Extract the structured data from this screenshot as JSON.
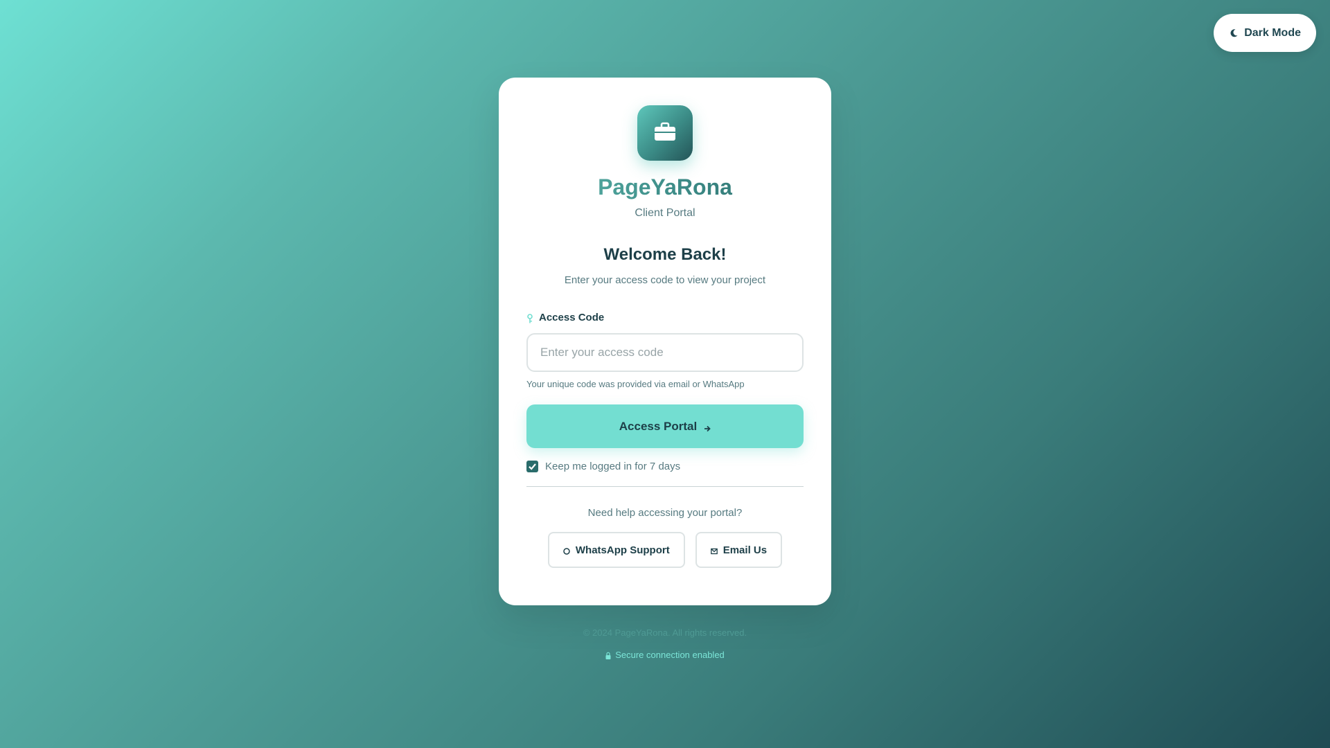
{
  "header": {
    "dark_mode_label": "Dark Mode",
    "dark_mode_icon": "moon-icon"
  },
  "brand": {
    "logo_icon": "briefcase-icon",
    "name": "PageYaRona",
    "subtitle": "Client Portal"
  },
  "welcome": {
    "title": "Welcome Back!",
    "subtitle": "Enter your access code to view your project"
  },
  "form": {
    "label": "Access Code",
    "label_icon": "key-icon",
    "placeholder": "Enter your access code",
    "value": "",
    "hint": "Your unique code was provided via email or WhatsApp",
    "submit_label": "Access Portal",
    "submit_icon": "arrow-right-icon",
    "remember_label": "Keep me logged in for 7 days",
    "remember_checked": true
  },
  "help": {
    "text": "Need help accessing your portal?",
    "whatsapp_label": "WhatsApp Support",
    "email_label": "Email Us"
  },
  "footer": {
    "copyright": "© 2024 PageYaRona. All rights reserved.",
    "secure": "Secure connection enabled"
  },
  "colors": {
    "accent": "#73ded1",
    "dark_text": "#1d3f48",
    "muted_text": "#567a80",
    "checkbox": "#2a6c6b"
  }
}
